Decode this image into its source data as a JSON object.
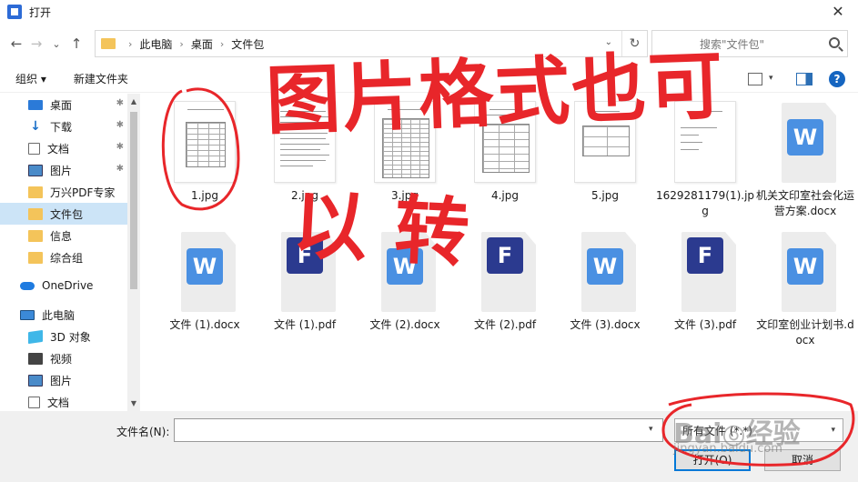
{
  "window": {
    "title": "打开",
    "close": "✕"
  },
  "nav": {
    "back": "←",
    "forward": "→",
    "recent": "⌄",
    "up": "↑"
  },
  "address": {
    "breadcrumbs": [
      "此电脑",
      "桌面",
      "文件包"
    ],
    "refresh": "↻",
    "dropdown": "⌄"
  },
  "search": {
    "placeholder": "搜索\"文件包\""
  },
  "toolbar": {
    "organize": "组织 ▾",
    "new_folder": "新建文件夹",
    "help": "?"
  },
  "sidebar": {
    "items": [
      {
        "label": "桌面",
        "icon": "desktop-icon",
        "pinned": true
      },
      {
        "label": "下载",
        "icon": "download-icon",
        "pinned": true
      },
      {
        "label": "文档",
        "icon": "document-icon",
        "pinned": true
      },
      {
        "label": "图片",
        "icon": "picture-icon",
        "pinned": true
      },
      {
        "label": "万兴PDF专家",
        "icon": "folder-icon",
        "pinned": false
      },
      {
        "label": "文件包",
        "icon": "folder-icon",
        "pinned": false,
        "selected": true
      },
      {
        "label": "信息",
        "icon": "folder-icon",
        "pinned": false
      },
      {
        "label": "综合组",
        "icon": "folder-icon",
        "pinned": false
      },
      {
        "label": "OneDrive",
        "icon": "cloud-icon",
        "pinned": false
      },
      {
        "label": "此电脑",
        "icon": "computer-icon",
        "pinned": false
      },
      {
        "label": "3D 对象",
        "icon": "3d-objects-icon",
        "pinned": false
      },
      {
        "label": "视频",
        "icon": "video-icon",
        "pinned": false
      },
      {
        "label": "图片",
        "icon": "picture-icon",
        "pinned": false
      },
      {
        "label": "文档",
        "icon": "document-icon",
        "pinned": false
      }
    ]
  },
  "files": [
    {
      "name": "1.jpg",
      "kind": "jpg"
    },
    {
      "name": "2.jpg",
      "kind": "jpg"
    },
    {
      "name": "3.jpg",
      "kind": "jpg"
    },
    {
      "name": "4.jpg",
      "kind": "jpg"
    },
    {
      "name": "5.jpg",
      "kind": "jpg"
    },
    {
      "name": "1629281179(1).jpg",
      "kind": "jpg"
    },
    {
      "name": "机关文印室社会化运营方案.docx",
      "kind": "docx",
      "badge": "W"
    },
    {
      "name": "文件 (1).docx",
      "kind": "docx",
      "badge": "W"
    },
    {
      "name": "文件 (1).pdf",
      "kind": "pdf",
      "badge": "F"
    },
    {
      "name": "文件 (2).docx",
      "kind": "docx",
      "badge": "W"
    },
    {
      "name": "文件 (2).pdf",
      "kind": "pdf",
      "badge": "F"
    },
    {
      "name": "文件 (3).docx",
      "kind": "docx",
      "badge": "W"
    },
    {
      "name": "文件 (3).pdf",
      "kind": "pdf",
      "badge": "F"
    },
    {
      "name": "文印室创业计划书.docx",
      "kind": "docx",
      "badge": "W"
    }
  ],
  "bottom": {
    "filename_label": "文件名(N):",
    "filename_value": "",
    "filter_value": "所有文件 (*.*)",
    "open_button": "打开(O)",
    "cancel_button": "取消"
  },
  "annotation": {
    "line1": "图片格式也可",
    "line2": "以转",
    "color": "#e8262a"
  },
  "watermark": {
    "main": "Bai◎经验",
    "sub": "jingyan.baidu.com"
  },
  "colors": {
    "selection": "#cce4f7",
    "accent": "#0078d7",
    "word": "#4a90e2",
    "pdf": "#2b3a8f"
  }
}
